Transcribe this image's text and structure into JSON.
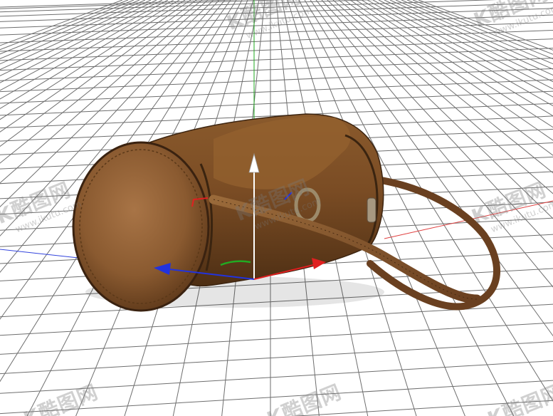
{
  "watermark": {
    "brand": "K酷图网",
    "url": "www.ikutu.com"
  },
  "icons": {
    "gizmo": "move-gizmo-icon",
    "object": "leather-handbag-model"
  },
  "colors": {
    "grid": "#6e6e6e",
    "axis_x": "#e02020",
    "axis_y": "#22aa22",
    "axis_z": "#2233dd",
    "leather": "#7a4a22"
  }
}
